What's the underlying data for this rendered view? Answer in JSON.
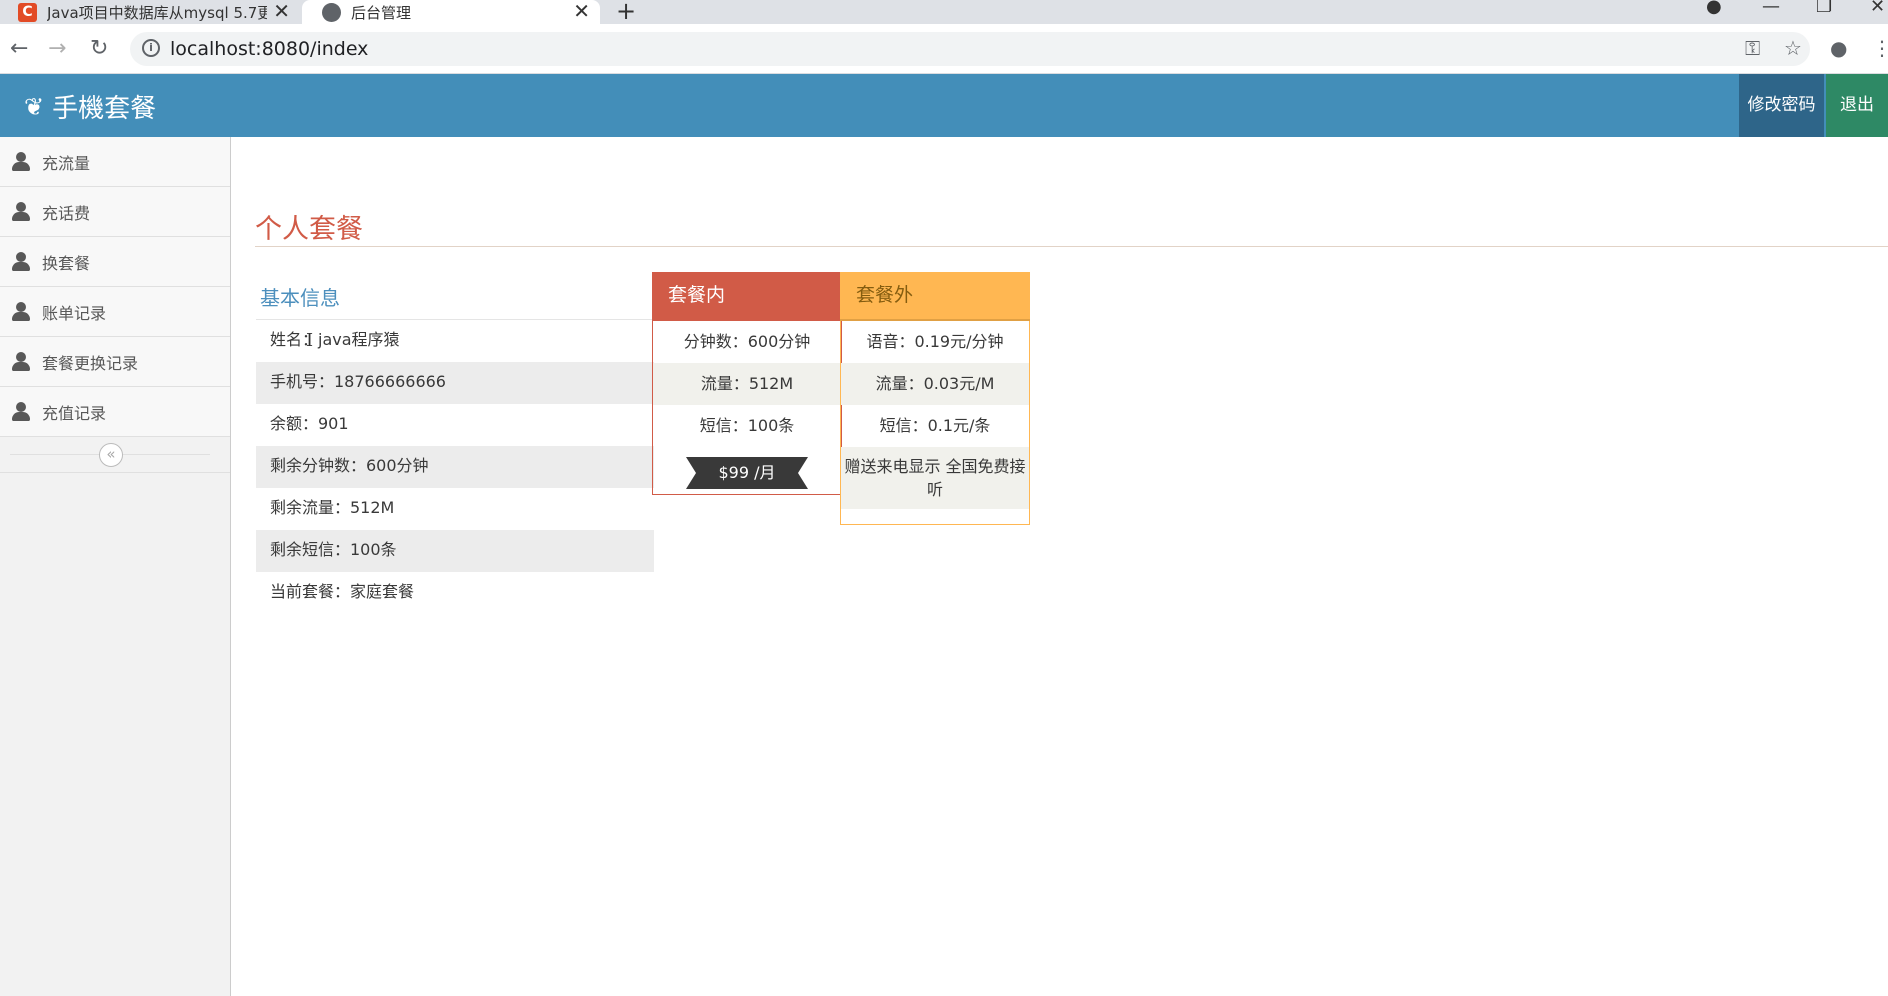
{
  "browser": {
    "tabs": [
      {
        "title": "Java项目中数据库从mysql 5.7更",
        "favicon": "C"
      },
      {
        "title": "后台管理"
      }
    ],
    "url": "localhost:8080/index"
  },
  "app": {
    "brand": "手機套餐",
    "header_buttons": {
      "change_password": "修改密码",
      "logout": "退出"
    },
    "colors": {
      "header": "#438eb9",
      "accent_red": "#d15b47",
      "accent_orange": "#ffb752",
      "title_blue": "#4c8fbd"
    }
  },
  "sidebar": {
    "items": [
      {
        "label": "充流量"
      },
      {
        "label": "充话费"
      },
      {
        "label": "换套餐"
      },
      {
        "label": "账单记录"
      },
      {
        "label": "套餐更换记录"
      },
      {
        "label": "充值记录"
      }
    ]
  },
  "main": {
    "title": "个人套餐",
    "basic_info": {
      "heading": "基本信息",
      "rows": [
        "姓名：java程序猿",
        "手机号：18766666666",
        "余额：901",
        "剩余分钟数：600分钟",
        "剩余流量：512M",
        "剩余短信：100条",
        "当前套餐：家庭套餐"
      ]
    },
    "plan_inner": {
      "heading": "套餐内",
      "rows": [
        "分钟数：600分钟",
        "流量：512M",
        "短信：100条"
      ],
      "price": "$99 /月"
    },
    "plan_outer": {
      "heading": "套餐外",
      "rows": [
        "语音：0.19元/分钟",
        "流量：0.03元/M",
        "短信：0.1元/条",
        "赠送来电显示 全国免费接听"
      ]
    }
  }
}
